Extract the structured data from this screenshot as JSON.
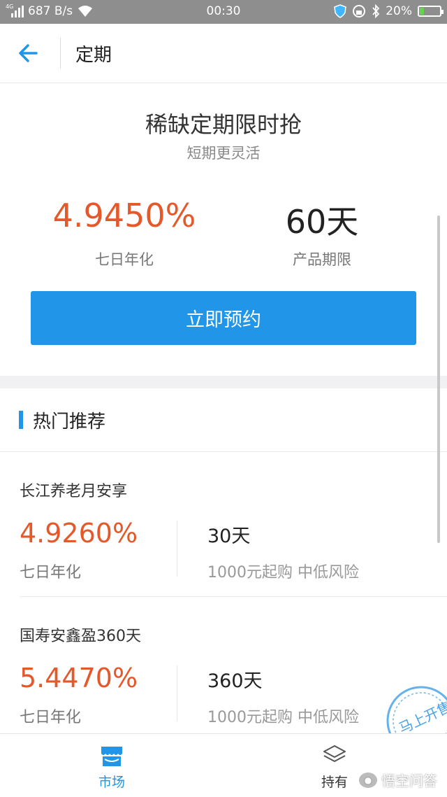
{
  "status_bar": {
    "network_tag": "4G",
    "speed": "687 B/s",
    "time": "00:30",
    "battery": "20%"
  },
  "header": {
    "title": "定期"
  },
  "hero": {
    "title": "稀缺定期限时抢",
    "subtitle": "短期更灵活",
    "rate": "4.9450%",
    "rate_label": "七日年化",
    "term": "60天",
    "term_label": "产品期限",
    "button": "立即预约"
  },
  "section": {
    "title": "热门推荐"
  },
  "products": [
    {
      "name": "长江养老月安享",
      "rate": "4.9260%",
      "rate_label": "七日年化",
      "term": "30天",
      "meta": "1000元起购 中低风险"
    },
    {
      "name": "国寿安鑫盈360天",
      "rate": "5.4470%",
      "rate_label": "七日年化",
      "term": "360天",
      "meta": "1000元起购 中低风险"
    }
  ],
  "stamp": {
    "text": "马上开售"
  },
  "bottom_nav": [
    {
      "label": "市场",
      "icon": "shop-icon",
      "active": true
    },
    {
      "label": "持有",
      "icon": "layers-icon",
      "active": false
    }
  ],
  "watermark": {
    "text": "悟空问答"
  },
  "colors": {
    "accent": "#2196e8",
    "rate": "#e4582a",
    "status_bar": "#8e8e8e"
  }
}
